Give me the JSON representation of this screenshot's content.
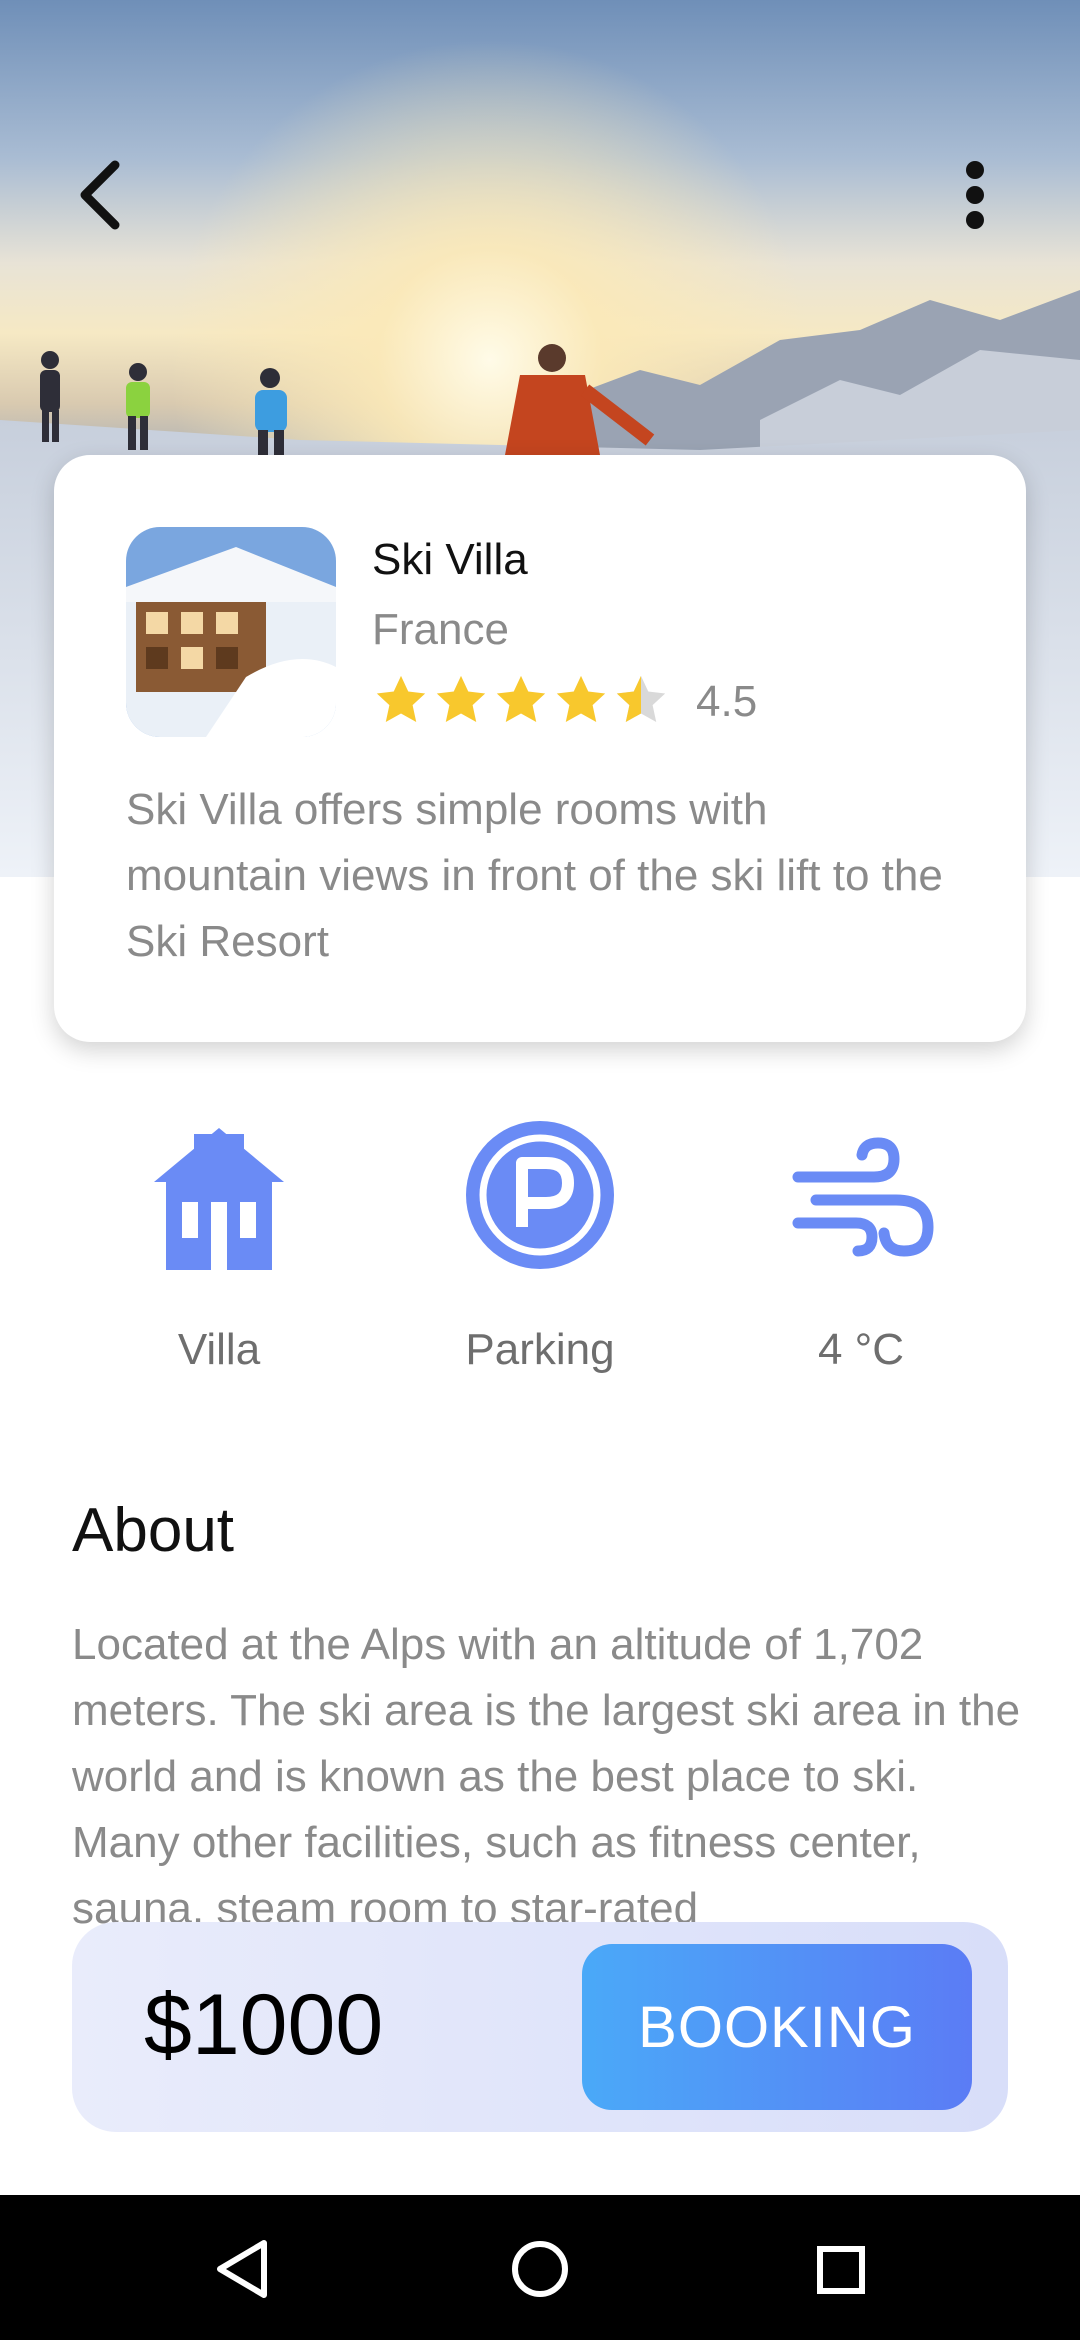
{
  "header": {
    "back_icon": "chevron-left-icon",
    "more_icon": "more-vertical-icon"
  },
  "property": {
    "name": "Ski Villa",
    "country": "France",
    "rating": "4.5",
    "rating_value": 4.5,
    "star_color": "#F8C82D",
    "description": "Ski Villa offers simple rooms with mountain views in front of the ski lift to the Ski Resort"
  },
  "amenities": [
    {
      "icon": "house-icon",
      "label": "Villa"
    },
    {
      "icon": "parking-icon",
      "label": "Parking"
    },
    {
      "icon": "wind-icon",
      "label": "4 °C"
    }
  ],
  "about": {
    "title": "About",
    "text": "Located at the Alps with an altitude of 1,702 meters. The ski area is the largest ski area in the world and is known as the best place to ski. Many other facilities, such as fitness center, sauna, steam room to star-rated"
  },
  "booking": {
    "price": "$1000",
    "button_label": "BOOKING"
  },
  "colors": {
    "accent": "#6A8BF5",
    "button_start": "#4AA9F8",
    "button_end": "#5B7CF5"
  },
  "navbar": {
    "items": [
      "back-triangle-icon",
      "home-circle-icon",
      "recents-square-icon"
    ]
  }
}
